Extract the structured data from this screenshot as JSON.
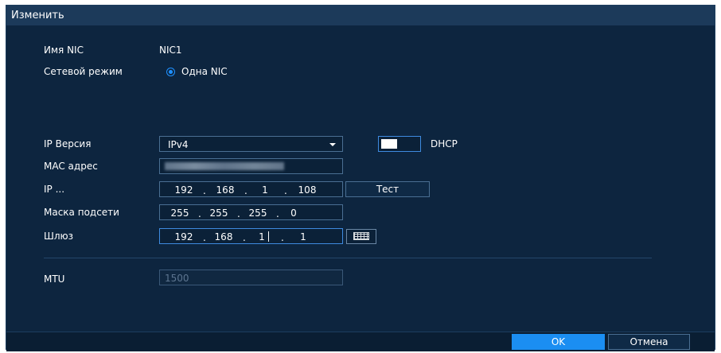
{
  "dialog": {
    "title": "Изменить"
  },
  "nic": {
    "label": "Имя NIC",
    "value": "NIC1"
  },
  "network_mode": {
    "label": "Сетевой режим",
    "option": "Одна NIC",
    "selected": true
  },
  "ip_version": {
    "label": "IP Версия",
    "value": "IPv4",
    "dhcp_label": "DHCP",
    "dhcp_enabled": false
  },
  "mac": {
    "label": "MAC адрес"
  },
  "ip": {
    "label": "IP ...",
    "octets": [
      "192",
      "168",
      "1",
      "108"
    ],
    "test_label": "Тест"
  },
  "subnet": {
    "label": "Маска подсети",
    "octets": [
      "255",
      "255",
      "255",
      "0"
    ]
  },
  "gateway": {
    "label": "Шлюз",
    "octets": [
      "192",
      "168",
      "1",
      "1"
    ]
  },
  "mtu": {
    "label": "MTU",
    "value": "1500"
  },
  "buttons": {
    "ok": "OK",
    "cancel": "Отмена"
  },
  "colors": {
    "background": "#0d253f",
    "accent": "#1b8ef2",
    "titlebar": "#1c3a5a"
  },
  "icons": {
    "keyboard": "keyboard-icon",
    "radio": "radio-selected-icon",
    "dropdown": "chevron-down-icon"
  }
}
